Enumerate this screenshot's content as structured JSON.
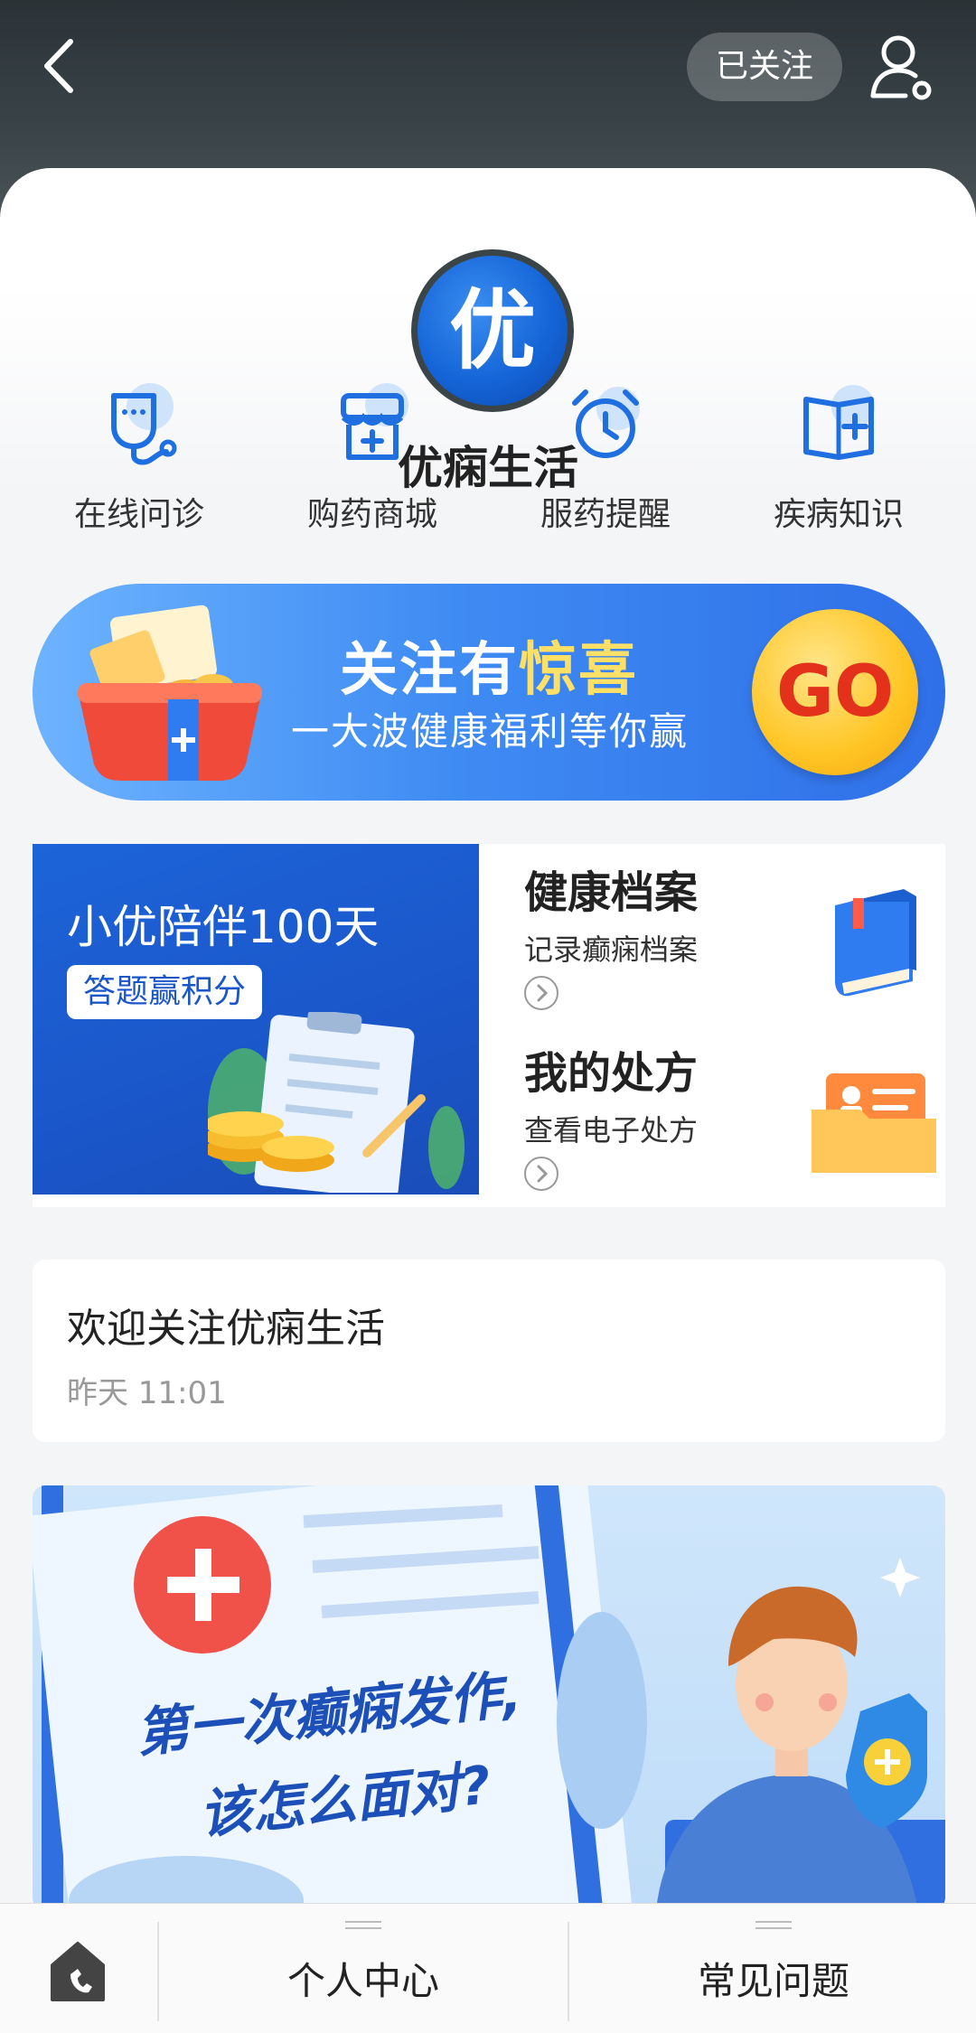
{
  "header": {
    "follow_label": "已关注"
  },
  "account": {
    "avatar_char": "优",
    "name": "优痫生活"
  },
  "services": [
    {
      "label": "在线问诊",
      "icon": "stethoscope-icon"
    },
    {
      "label": "购药商城",
      "icon": "store-icon"
    },
    {
      "label": "服药提醒",
      "icon": "alarm-clock-icon"
    },
    {
      "label": "疾病知识",
      "icon": "book-plus-icon"
    }
  ],
  "promo": {
    "title_plain": "关注有",
    "title_highlight": "惊喜",
    "subtitle": "一大波健康福利等你赢",
    "cta": "GO"
  },
  "companion": {
    "title": "小优陪伴100天",
    "tag": "答题赢积分"
  },
  "features": [
    {
      "title": "健康档案",
      "subtitle": "记录癫痫档案",
      "icon": "book-icon"
    },
    {
      "title": "我的处方",
      "subtitle": "查看电子处方",
      "icon": "folder-icon"
    }
  ],
  "message": {
    "title": "欢迎关注优痫生活",
    "time": "昨天 11:01"
  },
  "article": {
    "headline_line1": "第一次癫痫发作,",
    "headline_line2": "该怎么面对?"
  },
  "bottom_nav": {
    "items": [
      {
        "label": "个人中心"
      },
      {
        "label": "常见问题"
      }
    ]
  },
  "colors": {
    "brand_blue": "#1a56c9",
    "accent_yellow": "#ffe066",
    "go_red": "#e3311b"
  }
}
